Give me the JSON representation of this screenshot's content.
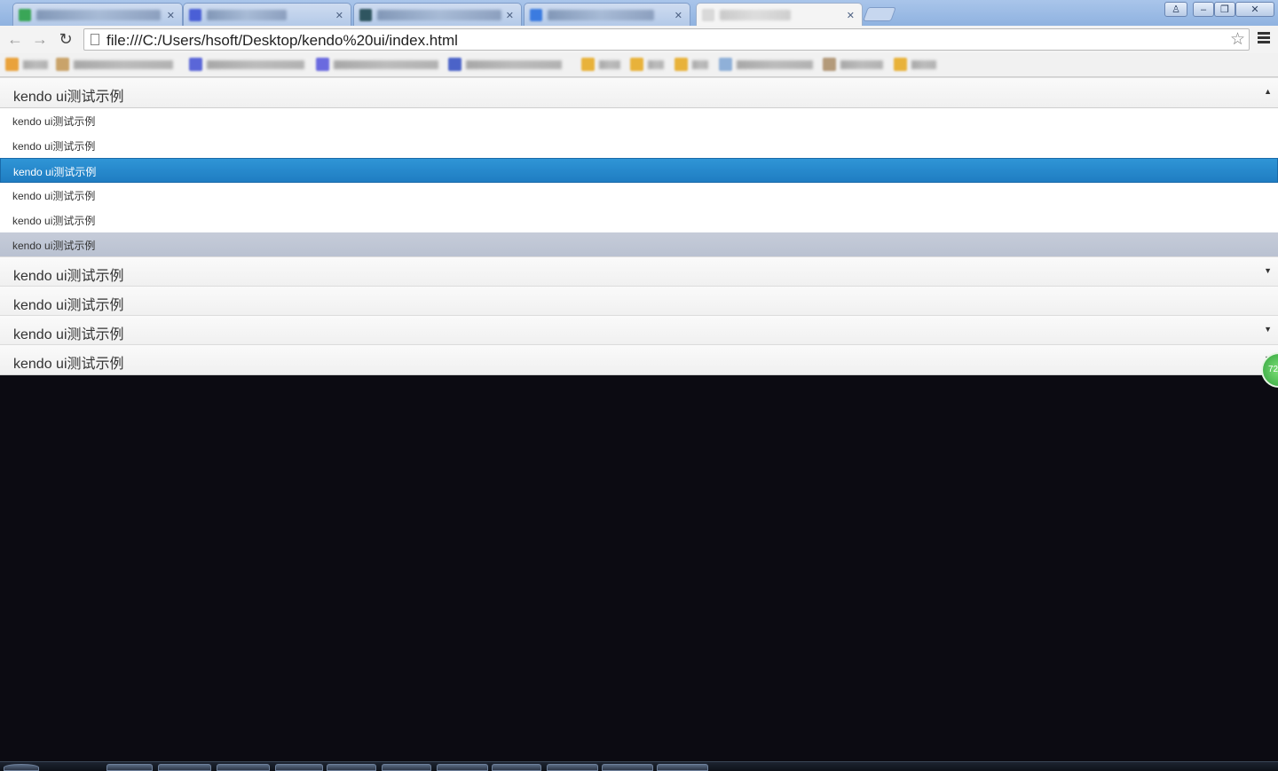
{
  "browser": {
    "url": "file:///C:/Users/hsoft/Desktop/kendo%20ui/index.html",
    "tabs": [
      {
        "fav_color": "#3aa657"
      },
      {
        "fav_color": "#4a5fd6"
      },
      {
        "fav_color": "#2f5560"
      },
      {
        "fav_color": "#3b7be0"
      },
      {
        "fav_color": "#d9d9d9",
        "active": true
      }
    ],
    "window_buttons": {
      "user": "♙",
      "minimize": "–",
      "restore": "❐",
      "close": "✕"
    },
    "nav": {
      "back": "←",
      "forward": "→",
      "reload": "↻",
      "star": "☆"
    },
    "bookmarks": [
      {
        "icon_color": "#e9a23b"
      },
      {
        "icon_color": "#c9a36a"
      },
      {
        "icon_color": "#5a66d8"
      },
      {
        "icon_color": "#6a6adf"
      },
      {
        "icon_color": "#4b63c8"
      },
      {
        "icon_color": "#e8b23a"
      },
      {
        "icon_color": "#e8b23a"
      },
      {
        "icon_color": "#e8b23a"
      },
      {
        "icon_color": "#8fb0d8"
      },
      {
        "icon_color": "#b39a7a"
      },
      {
        "icon_color": "#e8b23a"
      }
    ]
  },
  "panelbar": {
    "expanded_header": {
      "label": "kendo ui测试示例",
      "arrow": "▲"
    },
    "items": [
      {
        "label": "kendo ui测试示例",
        "state": "normal"
      },
      {
        "label": "kendo ui测试示例",
        "state": "normal"
      },
      {
        "label": "kendo ui测试示例",
        "state": "selected"
      },
      {
        "label": "kendo ui测试示例",
        "state": "normal"
      },
      {
        "label": "kendo ui测试示例",
        "state": "normal"
      },
      {
        "label": "kendo ui测试示例",
        "state": "hover"
      }
    ],
    "collapsed_headers": [
      {
        "label": "kendo ui测试示例",
        "arrow": "▼"
      },
      {
        "label": "kendo ui测试示例",
        "arrow": ""
      },
      {
        "label": "kendo ui测试示例",
        "arrow": "▼"
      },
      {
        "label": "kendo ui测试示例",
        "arrow": "▼"
      }
    ],
    "floater_text": "72"
  },
  "colors": {
    "selected": "#2487cc",
    "hover": "#c1c8d6",
    "desktop": "#0c0b12"
  }
}
